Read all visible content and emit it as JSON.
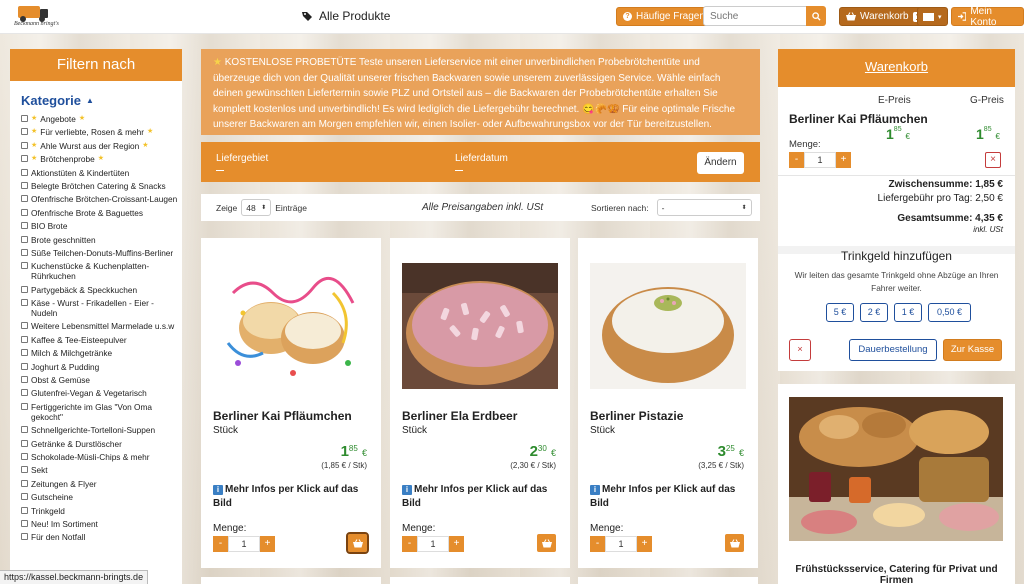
{
  "header": {
    "logo_text": "Beckmann bringt's",
    "all_products": "Alle Produkte",
    "faq": "Häufige Fragen",
    "search_placeholder": "Suche",
    "cart_label": "Warenkorb",
    "cart_count": "1",
    "account": "Mein Konto"
  },
  "sidebar": {
    "title": "Filtern nach",
    "category_title": "Kategorie",
    "items": [
      {
        "label": "Angebote",
        "star": true
      },
      {
        "label": "Für verliebte, Rosen & mehr",
        "star": true
      },
      {
        "label": "Ahle Wurst aus der Region",
        "star": true
      },
      {
        "label": "Brötchenprobe",
        "star": true
      },
      {
        "label": "Aktionstüten & Kindertüten",
        "star": false
      },
      {
        "label": "Belegte Brötchen Catering & Snacks",
        "star": false
      },
      {
        "label": "Ofenfrische Brötchen-Croissant-Laugen",
        "star": false
      },
      {
        "label": "Ofenfrische Brote & Baguettes",
        "star": false
      },
      {
        "label": "BIO Brote",
        "star": false
      },
      {
        "label": "Brote geschnitten",
        "star": false
      },
      {
        "label": "Süße Teilchen-Donuts-Muffins-Berliner",
        "star": false
      },
      {
        "label": "Kuchenstücke & Kuchenplatten-Rührkuchen",
        "star": false
      },
      {
        "label": "Partygebäck & Speckkuchen",
        "star": false
      },
      {
        "label": "Käse - Wurst - Frikadellen - Eier - Nudeln",
        "star": false
      },
      {
        "label": "Weitere Lebensmittel Marmelade u.s.w",
        "star": false
      },
      {
        "label": "Kaffee & Tee-Eisteepulver",
        "star": false
      },
      {
        "label": "Milch & Milchgetränke",
        "star": false
      },
      {
        "label": "Joghurt & Pudding",
        "star": false
      },
      {
        "label": "Obst & Gemüse",
        "star": false
      },
      {
        "label": "Glutenfrei-Vegan & Vegetarisch",
        "star": false
      },
      {
        "label": "Fertiggerichte im Glas \"Von Oma gekocht\"",
        "star": false
      },
      {
        "label": "Schnellgerichte-Tortelloni-Suppen",
        "star": false
      },
      {
        "label": "Getränke & Durstlöscher",
        "star": false
      },
      {
        "label": "Schokolade-Müsli-Chips & mehr",
        "star": false
      },
      {
        "label": "Sekt",
        "star": false
      },
      {
        "label": "Zeitungen & Flyer",
        "star": false
      },
      {
        "label": "Gutscheine",
        "star": false
      },
      {
        "label": "Trinkgeld",
        "star": false
      },
      {
        "label": "Neu! Im Sortiment",
        "star": false
      },
      {
        "label": "Für den Notfall",
        "star": false
      }
    ]
  },
  "promo": {
    "text": "KOSTENLOSE PROBETÜTE Teste unseren Lieferservice mit einer unverbindlichen Probebrötchentüte und überzeuge dich von der Qualität unserer frischen Backwaren sowie unserem zuverlässigen Service. Wähle einfach deinen gewünschten Liefertermin sowie PLZ und Ortsteil aus – die Backwaren der Probebrötchentüte erhalten Sie komplett kostenlos und unverbindlich! Es wird lediglich die Liefergebühr berechnet. 😋🥐🥨 Für eine optimale Frische unserer Backwaren am Morgen empfehlen wir, einen Isolier- oder Aufbewahrungsbox vor der Tür bereitzustellen."
  },
  "delivery": {
    "area_label": "Liefergebiet",
    "date_label": "Lieferdatum",
    "change": "Ändern"
  },
  "filterbar": {
    "show": "Zeige",
    "per_page": "48",
    "entries": "Einträge",
    "price_note": "Alle Preisangaben inkl. USt",
    "sort_label": "Sortieren nach:",
    "sort_value": "-"
  },
  "products": [
    {
      "name": "Berliner Kai Pfläumchen",
      "unit": "Stück",
      "price_int": "1",
      "price_dec": "85",
      "currency": "€",
      "per_unit": "(1,85 € / Stk)",
      "info": "Mehr Infos per Klick auf das Bild",
      "qty_label": "Menge:",
      "qty": "1",
      "minus": "-",
      "plus": "+"
    },
    {
      "name": "Berliner Ela Erdbeer",
      "unit": "Stück",
      "price_int": "2",
      "price_dec": "30",
      "currency": "€",
      "per_unit": "(2,30 € / Stk)",
      "info": "Mehr Infos per Klick auf das Bild",
      "qty_label": "Menge:",
      "qty": "1",
      "minus": "-",
      "plus": "+"
    },
    {
      "name": "Berliner Pistazie",
      "unit": "Stück",
      "price_int": "3",
      "price_dec": "25",
      "currency": "€",
      "per_unit": "(3,25 € / Stk)",
      "info": "Mehr Infos per Klick auf das Bild",
      "qty_label": "Menge:",
      "qty": "1",
      "minus": "-",
      "plus": "+"
    }
  ],
  "cart": {
    "title": "Warenkorb",
    "col_e": "E-Preis",
    "col_g": "G-Preis",
    "item_name": "Berliner Kai Pfläumchen",
    "e_int": "1",
    "e_dec": "85",
    "g_int": "1",
    "g_dec": "85",
    "currency": "€",
    "qty_label": "Menge:",
    "qty": "1",
    "minus": "-",
    "plus": "+",
    "remove": "×",
    "subtotal": "Zwischensumme: 1,85 €",
    "delivery_fee": "Liefergebühr pro Tag: 2,50 €",
    "total": "Gesamtsumme: 4,35 €",
    "vat": "inkl. USt",
    "tip_title": "Trinkgeld hinzufügen",
    "tip_text": "Wir leiten das gesamte Trinkgeld ohne Abzüge an Ihren Fahrer weiter.",
    "tips": [
      "5 €",
      "2 €",
      "1 €",
      "0,50 €"
    ],
    "clear": "×",
    "standing_order": "Dauerbestellung",
    "checkout": "Zur Kasse"
  },
  "catering": {
    "caption": "Frühstücksservice, Catering für Privat und Firmen"
  },
  "status_url": "https://kassel.beckmann-bringts.de",
  "colors": {
    "accent": "#e58d2c",
    "accent_dark": "#b5691d",
    "price_green": "#2e8b2e",
    "link_blue": "#1f4f9c",
    "promo": "#e9a25a"
  }
}
